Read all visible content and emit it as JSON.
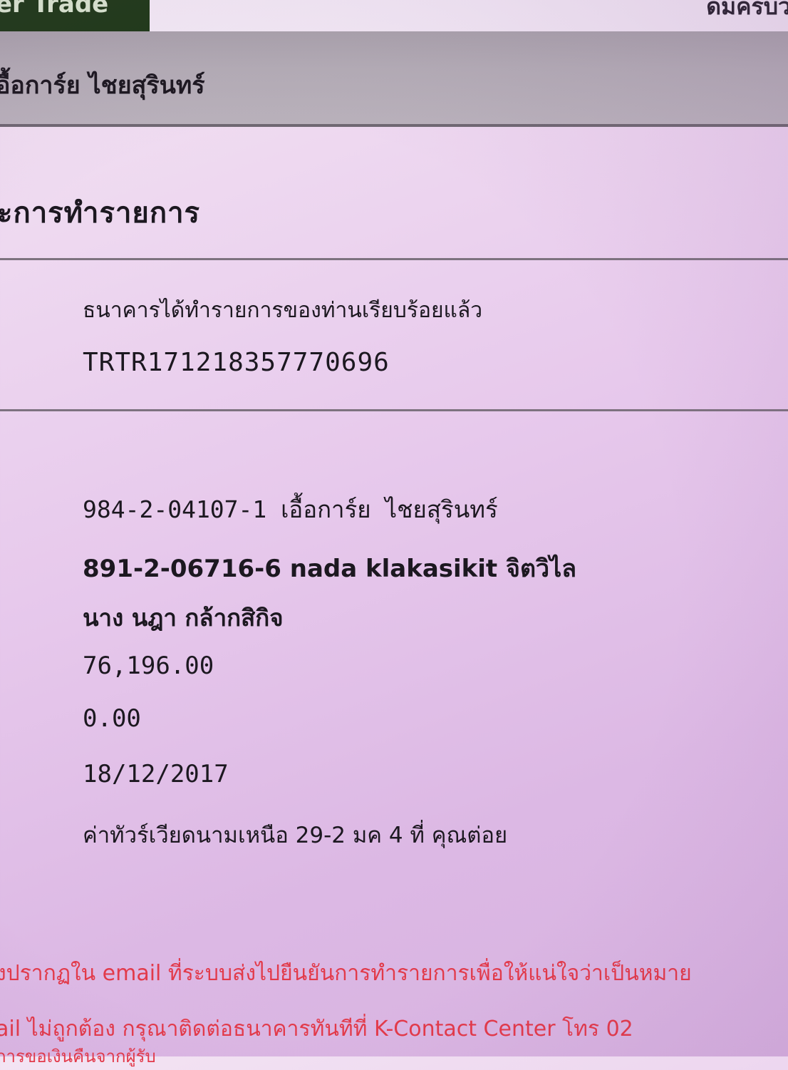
{
  "header": {
    "brand_text": "er Trade",
    "top_right_text": "ดมครบว"
  },
  "account_holder_bar": {
    "name": "อื้อการ์ย ไชยสุรินทร์"
  },
  "section": {
    "title": "ะการทำรายการ"
  },
  "confirmation": {
    "status_message": "ธนาคารได้ทำรายการของท่านเรียบร้อยแล้ว",
    "reference_number": "TRTR171218357770696"
  },
  "transaction": {
    "from_account": "984-2-04107-1 เอื้อการ์ย ไชยสุรินทร์",
    "to_account": "891-2-06716-6 nada klakasikit จิตวิไล",
    "to_account_name": "นาง นฎา กล้ากสิกิจ",
    "amount": "76,196.00",
    "fee": "0.00",
    "date": "18/12/2017",
    "memo": "ค่าทัวร์เวียดนามเหนือ 29-2 มค 4 ที่ คุณต่อย"
  },
  "notice": {
    "line1": "ังปรากฏใน email ที่ระบบส่งไปยืนยันการทำรายการเพื่อให้แน่ใจว่าเป็นหมาย",
    "line2": "ail ไม่ถูกต้อง กรุณาติดต่อธนาคารทันทีที่ K-Contact Center โทร 02",
    "line3": "การขอเงินคืนจากผู้รับ"
  },
  "colors": {
    "background": "#e7c9ec",
    "brand_tab": "#1f3a18",
    "name_bar": "#b3acb5",
    "notice_text": "#e23a4a"
  }
}
